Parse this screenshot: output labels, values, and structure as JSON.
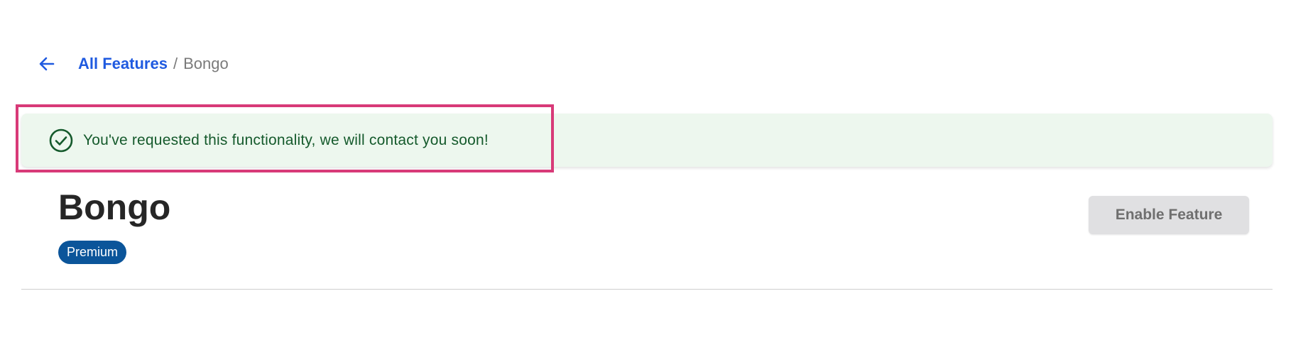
{
  "breadcrumb": {
    "back_icon": "arrow-left-icon",
    "parent_label": "All Features",
    "separator": "/",
    "current_label": "Bongo"
  },
  "alert": {
    "icon": "check-circle-icon",
    "message": "You've requested this functionality, we will contact you soon!",
    "status": "success"
  },
  "feature": {
    "title": "Bongo",
    "badge": "Premium",
    "enable_button_label": "Enable Feature",
    "enable_button_disabled": true
  },
  "colors": {
    "link": "#1f5ae0",
    "alert_bg": "#edf7ee",
    "alert_text": "#155a2c",
    "badge_bg": "#0b559a",
    "highlight": "#d83a78",
    "button_disabled_bg": "#e0e0e2"
  }
}
